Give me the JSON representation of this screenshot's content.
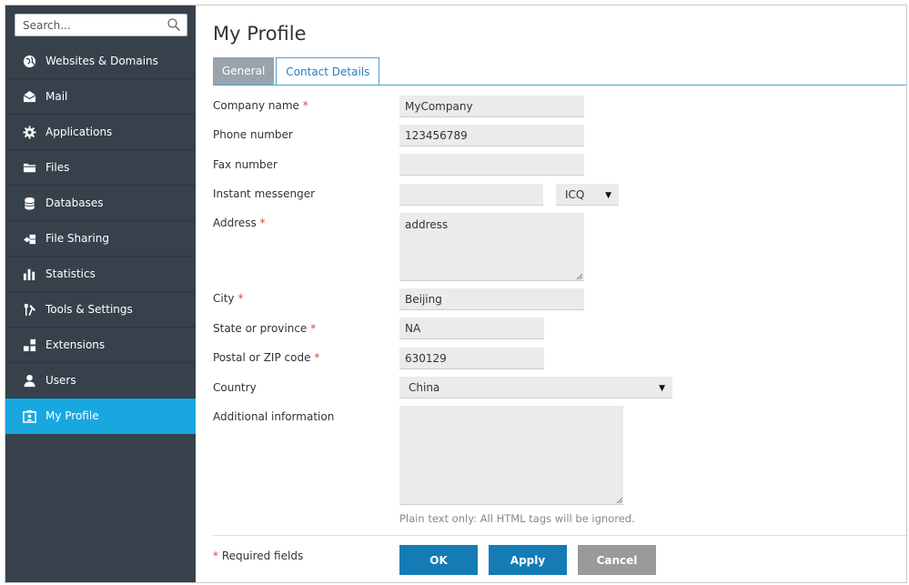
{
  "search": {
    "placeholder": "Search..."
  },
  "sidebar": {
    "items": [
      {
        "label": "Websites & Domains",
        "icon": "globe-icon"
      },
      {
        "label": "Mail",
        "icon": "mail-icon"
      },
      {
        "label": "Applications",
        "icon": "gear-icon"
      },
      {
        "label": "Files",
        "icon": "folder-icon"
      },
      {
        "label": "Databases",
        "icon": "database-icon"
      },
      {
        "label": "File Sharing",
        "icon": "file-sharing-icon"
      },
      {
        "label": "Statistics",
        "icon": "bar-chart-icon"
      },
      {
        "label": "Tools & Settings",
        "icon": "tools-icon"
      },
      {
        "label": "Extensions",
        "icon": "extensions-icon"
      },
      {
        "label": "Users",
        "icon": "user-icon"
      },
      {
        "label": "My Profile",
        "icon": "profile-card-icon",
        "active": true
      }
    ],
    "colors": {
      "background": "#37414b",
      "active": "#19a7e0"
    }
  },
  "page": {
    "title": "My Profile"
  },
  "tabs": [
    {
      "label": "General",
      "active": false
    },
    {
      "label": "Contact Details",
      "active": true
    }
  ],
  "form": {
    "company_name": {
      "label": "Company name",
      "value": "MyCompany",
      "required": "*"
    },
    "phone": {
      "label": "Phone number",
      "value": "123456789"
    },
    "fax": {
      "label": "Fax number",
      "value": ""
    },
    "messenger": {
      "label": "Instant messenger",
      "value": "",
      "type": "ICQ"
    },
    "address": {
      "label": "Address",
      "value": "address",
      "required": "*"
    },
    "city": {
      "label": "City",
      "value": "Beijing",
      "required": "*"
    },
    "state": {
      "label": "State or province",
      "value": "NA",
      "required": "*"
    },
    "postal": {
      "label": "Postal or ZIP code",
      "value": "630129",
      "required": "*"
    },
    "country": {
      "label": "Country",
      "value": "China"
    },
    "additional": {
      "label": "Additional information",
      "value": "",
      "hint": "Plain text only: All HTML tags will be ignored."
    }
  },
  "footer": {
    "required_star": "*",
    "required_note": "Required fields",
    "ok_label": "OK",
    "apply_label": "Apply",
    "cancel_label": "Cancel"
  },
  "colors": {
    "primary_button": "#157bb5",
    "cancel_button": "#9a9a9a",
    "required": "#e0443a",
    "tab_active": "#2b7fb8"
  }
}
